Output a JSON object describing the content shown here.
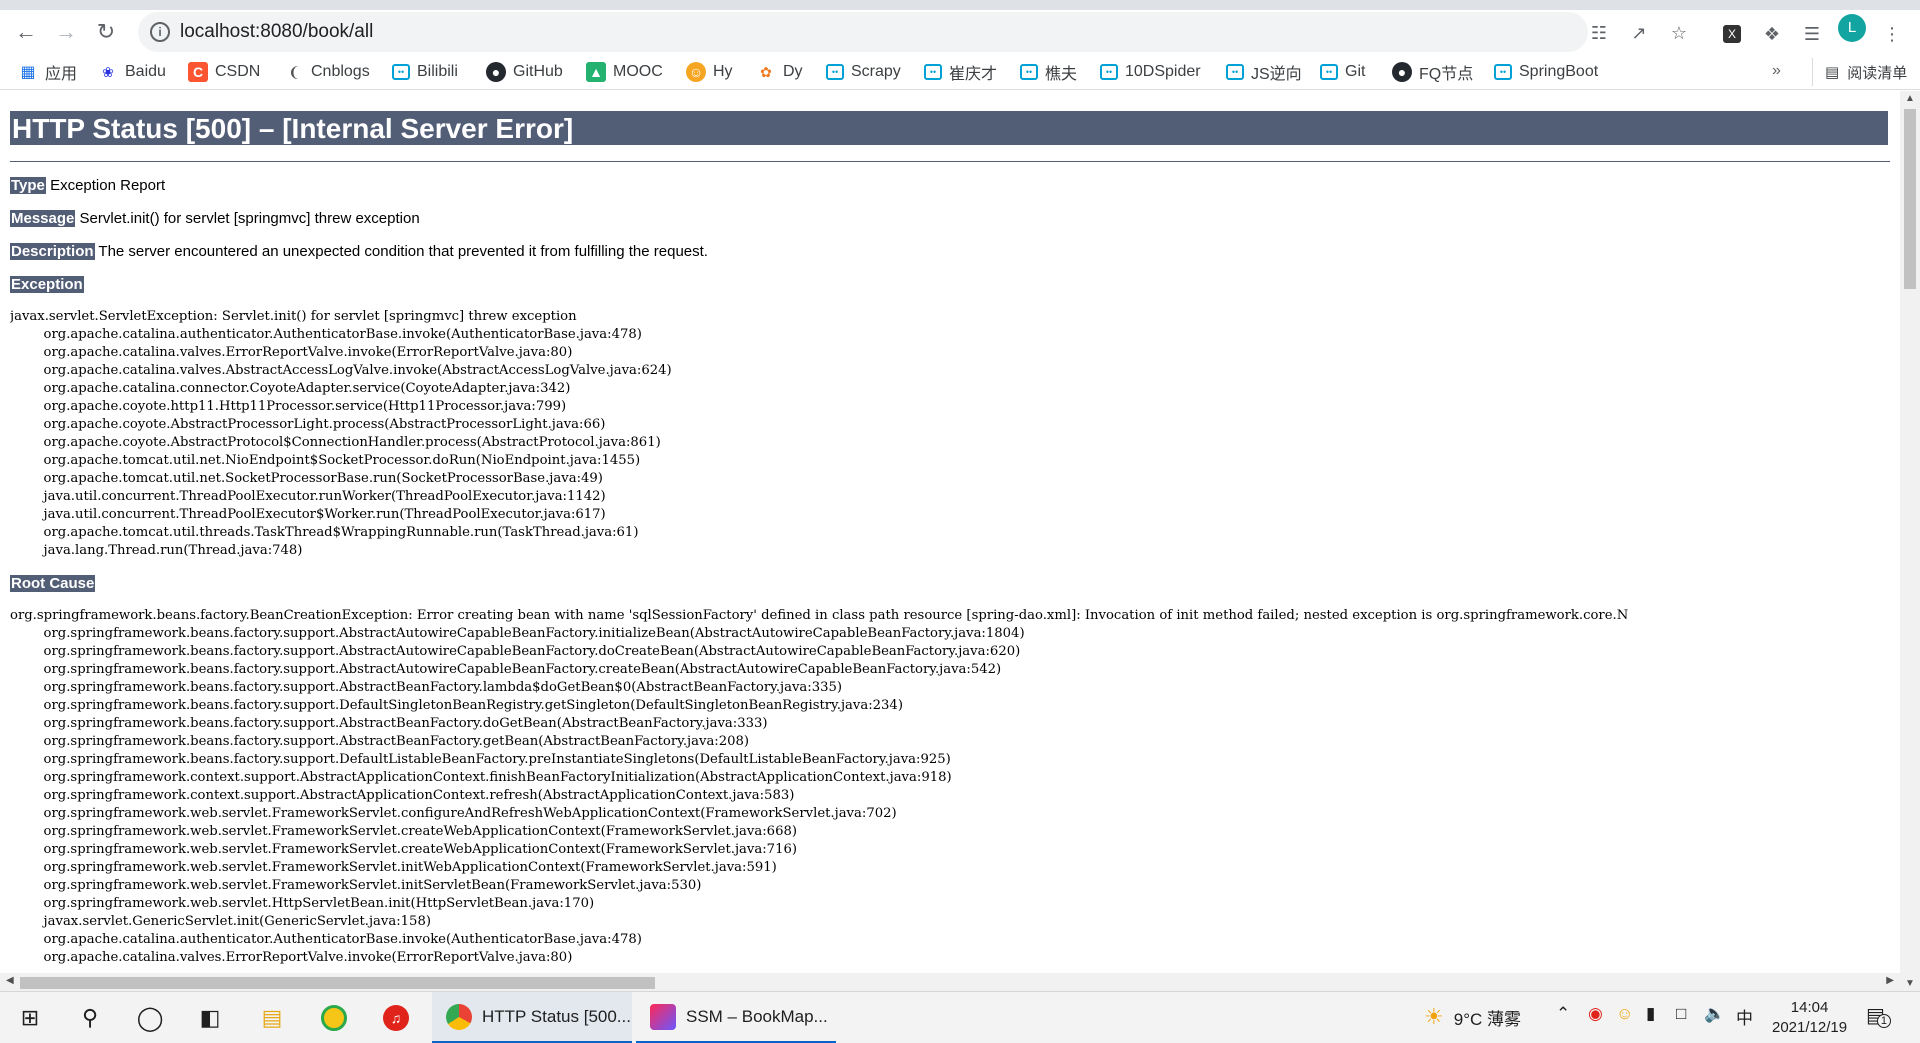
{
  "browser": {
    "url": "localhost:8080/book/all",
    "avatar_letter": "L"
  },
  "bookmarks": [
    {
      "label": "应用",
      "icon": "apps-grid-icon"
    },
    {
      "label": "Baidu",
      "icon": "baidu-paw-icon"
    },
    {
      "label": "CSDN",
      "icon": "csdn-icon"
    },
    {
      "label": "Cnblogs",
      "icon": "cnblogs-icon"
    },
    {
      "label": "Bilibili",
      "icon": "bilibili-icon"
    },
    {
      "label": "GitHub",
      "icon": "github-icon"
    },
    {
      "label": "MOOC",
      "icon": "mooc-icon"
    },
    {
      "label": "Hy",
      "icon": "huya-icon"
    },
    {
      "label": "Dy",
      "icon": "douyu-icon"
    },
    {
      "label": "Scrapy",
      "icon": "bilibili-icon"
    },
    {
      "label": "崔庆才",
      "icon": "bilibili-icon"
    },
    {
      "label": "樵夫",
      "icon": "bilibili-icon"
    },
    {
      "label": "10DSpider",
      "icon": "bilibili-icon"
    },
    {
      "label": "JS逆向",
      "icon": "bilibili-icon"
    },
    {
      "label": "Git",
      "icon": "bilibili-icon"
    },
    {
      "label": "FQ节点",
      "icon": "github-icon"
    },
    {
      "label": "SpringBoot",
      "icon": "bilibili-icon"
    }
  ],
  "bookmarks_more": "»",
  "reading_list": "阅读清单",
  "page": {
    "title": "HTTP Status [500] – [Internal Server Error]",
    "type_label": "Type",
    "type_value": "Exception Report",
    "message_label": "Message",
    "message_value": "Servlet.init() for servlet [springmvc] threw exception",
    "description_label": "Description",
    "description_value": "The server encountered an unexpected condition that prevented it from fulfilling the request.",
    "exception_label": "Exception",
    "exception_trace": "javax.servlet.ServletException: Servlet.init() for servlet [springmvc] threw exception\n\torg.apache.catalina.authenticator.AuthenticatorBase.invoke(AuthenticatorBase.java:478)\n\torg.apache.catalina.valves.ErrorReportValve.invoke(ErrorReportValve.java:80)\n\torg.apache.catalina.valves.AbstractAccessLogValve.invoke(AbstractAccessLogValve.java:624)\n\torg.apache.catalina.connector.CoyoteAdapter.service(CoyoteAdapter.java:342)\n\torg.apache.coyote.http11.Http11Processor.service(Http11Processor.java:799)\n\torg.apache.coyote.AbstractProcessorLight.process(AbstractProcessorLight.java:66)\n\torg.apache.coyote.AbstractProtocol$ConnectionHandler.process(AbstractProtocol.java:861)\n\torg.apache.tomcat.util.net.NioEndpoint$SocketProcessor.doRun(NioEndpoint.java:1455)\n\torg.apache.tomcat.util.net.SocketProcessorBase.run(SocketProcessorBase.java:49)\n\tjava.util.concurrent.ThreadPoolExecutor.runWorker(ThreadPoolExecutor.java:1142)\n\tjava.util.concurrent.ThreadPoolExecutor$Worker.run(ThreadPoolExecutor.java:617)\n\torg.apache.tomcat.util.threads.TaskThread$WrappingRunnable.run(TaskThread.java:61)\n\tjava.lang.Thread.run(Thread.java:748)",
    "root_cause_label": "Root Cause",
    "root_cause_trace": "org.springframework.beans.factory.BeanCreationException: Error creating bean with name 'sqlSessionFactory' defined in class path resource [spring-dao.xml]: Invocation of init method failed; nested exception is org.springframework.core.N\n\torg.springframework.beans.factory.support.AbstractAutowireCapableBeanFactory.initializeBean(AbstractAutowireCapableBeanFactory.java:1804)\n\torg.springframework.beans.factory.support.AbstractAutowireCapableBeanFactory.doCreateBean(AbstractAutowireCapableBeanFactory.java:620)\n\torg.springframework.beans.factory.support.AbstractAutowireCapableBeanFactory.createBean(AbstractAutowireCapableBeanFactory.java:542)\n\torg.springframework.beans.factory.support.AbstractBeanFactory.lambda$doGetBean$0(AbstractBeanFactory.java:335)\n\torg.springframework.beans.factory.support.DefaultSingletonBeanRegistry.getSingleton(DefaultSingletonBeanRegistry.java:234)\n\torg.springframework.beans.factory.support.AbstractBeanFactory.doGetBean(AbstractBeanFactory.java:333)\n\torg.springframework.beans.factory.support.AbstractBeanFactory.getBean(AbstractBeanFactory.java:208)\n\torg.springframework.beans.factory.support.DefaultListableBeanFactory.preInstantiateSingletons(DefaultListableBeanFactory.java:925)\n\torg.springframework.context.support.AbstractApplicationContext.finishBeanFactoryInitialization(AbstractApplicationContext.java:918)\n\torg.springframework.context.support.AbstractApplicationContext.refresh(AbstractApplicationContext.java:583)\n\torg.springframework.web.servlet.FrameworkServlet.configureAndRefreshWebApplicationContext(FrameworkServlet.java:702)\n\torg.springframework.web.servlet.FrameworkServlet.createWebApplicationContext(FrameworkServlet.java:668)\n\torg.springframework.web.servlet.FrameworkServlet.createWebApplicationContext(FrameworkServlet.java:716)\n\torg.springframework.web.servlet.FrameworkServlet.initWebApplicationContext(FrameworkServlet.java:591)\n\torg.springframework.web.servlet.FrameworkServlet.initServletBean(FrameworkServlet.java:530)\n\torg.springframework.web.servlet.HttpServletBean.init(HttpServletBean.java:170)\n\tjavax.servlet.GenericServlet.init(GenericServlet.java:158)\n\torg.apache.catalina.authenticator.AuthenticatorBase.invoke(AuthenticatorBase.java:478)\n\torg.apache.catalina.valves.ErrorReportValve.invoke(ErrorReportValve.java:80)"
  },
  "taskbar": {
    "apps": [
      {
        "label": "HTTP Status [500...",
        "icon": "chrome-icon"
      },
      {
        "label": "SSM – BookMap...",
        "icon": "intellij-icon"
      }
    ],
    "weather": "9°C 薄雾",
    "ime": "中",
    "time": "14:04",
    "date": "2021/12/19",
    "notification_count": "1"
  },
  "colors": {
    "heading_bg": "#525d76",
    "heading_fg": "#ffffff",
    "taskbar_accent": "#0a64c8",
    "avatar": "#12a4a0"
  }
}
